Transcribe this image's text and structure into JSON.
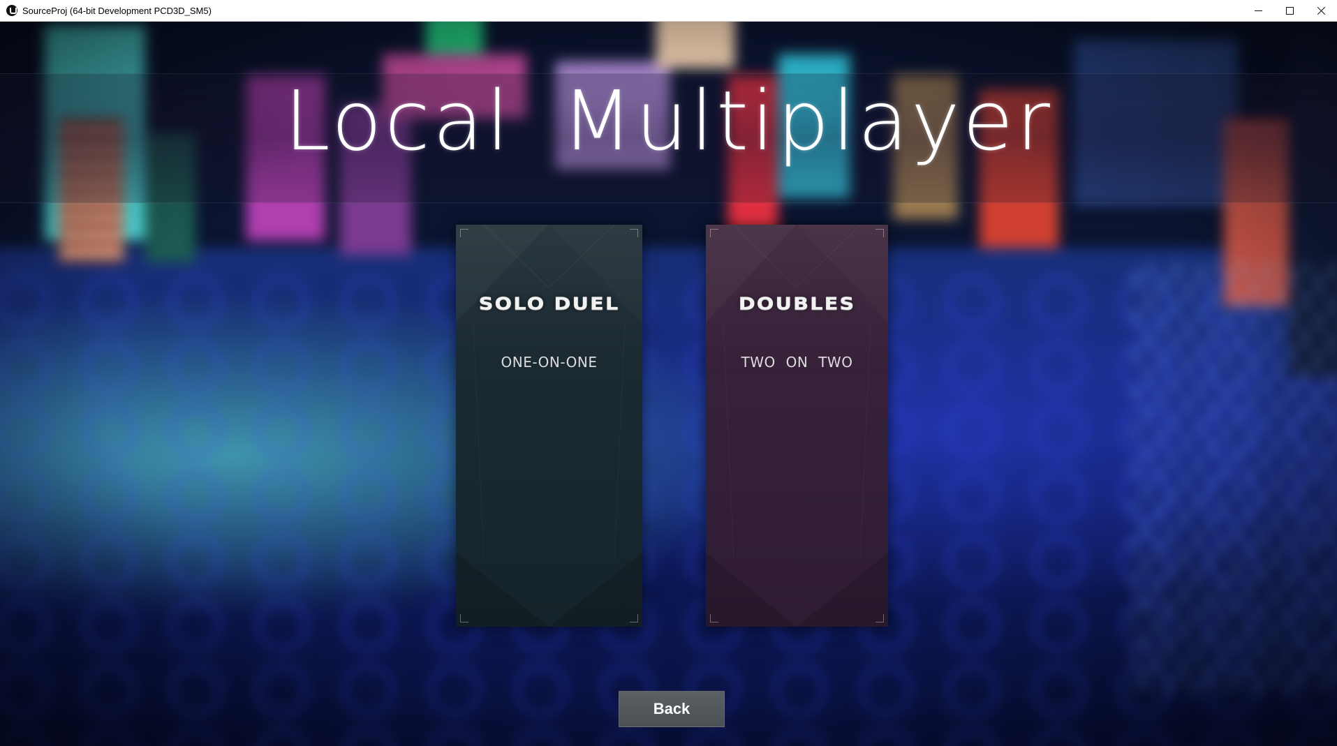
{
  "window": {
    "title": "SourceProj (64-bit Development PCD3D_SM5)",
    "icon": "unreal-engine-icon"
  },
  "screen": {
    "title": "Local Multiplayer"
  },
  "modes": [
    {
      "name": "SOLO DUEL",
      "subtitle": "ONE-ON-ONE",
      "color": "#1a2830"
    },
    {
      "name": "DOUBLES",
      "subtitle": "TWO ON TWO",
      "color": "#35203a"
    }
  ],
  "back_button": {
    "label": "Back"
  },
  "colors": {
    "title_text": "#ffffff",
    "back_button": "#52585c"
  }
}
